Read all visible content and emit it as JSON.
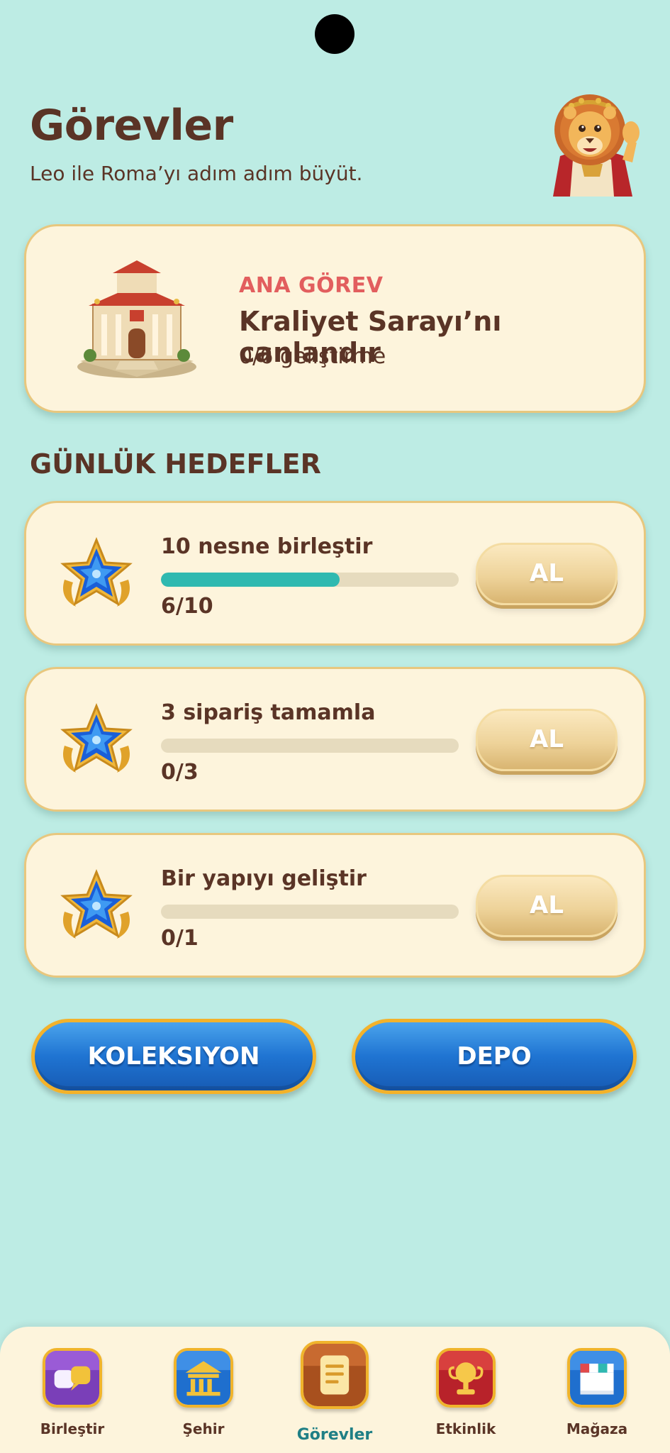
{
  "header": {
    "title": "Görevler",
    "subtitle": "Leo ile Roma’yı adım adım büyüt."
  },
  "main_quest": {
    "tag": "ANA GÖREV",
    "name": "Kraliyet Sarayı’nı canlandır",
    "progress": "0/6 geliştirme"
  },
  "daily": {
    "title": "GÜNLÜK HEDEFLER",
    "goals": [
      {
        "label": "10 nesne birleştir",
        "count": "6/10",
        "progress": 0.6,
        "button": "AL",
        "icon": "star-badge-icon"
      },
      {
        "label": "3 sipariş tamamla",
        "count": "0/3",
        "progress": 0,
        "button": "AL",
        "icon": "star-badge-icon"
      },
      {
        "label": "Bir yapıyı geliştir",
        "count": "0/1",
        "progress": 0,
        "button": "AL",
        "icon": "star-badge-icon"
      }
    ]
  },
  "actions": {
    "collection": "KOLEKSIYON",
    "depot": "DEPO"
  },
  "nav": {
    "items": [
      {
        "label": "Birleştir",
        "icon": "merge-icon",
        "active": false
      },
      {
        "label": "Şehir",
        "icon": "city-hall-icon",
        "active": false
      },
      {
        "label": "Görevler",
        "icon": "quest-scroll-icon",
        "active": true
      },
      {
        "label": "Etkinlik",
        "icon": "trophy-icon",
        "active": false
      },
      {
        "label": "Mağaza",
        "icon": "shop-icon",
        "active": false
      }
    ]
  },
  "colors": {
    "background": "#bdece4",
    "card": "#fdf4dc",
    "accent_red": "#e25e5e",
    "progress_fill": "#2fb9b0",
    "button_blue": "#1f74d2",
    "button_border": "#f3b22a",
    "text_brown": "#5a3426",
    "active_nav": "#1f7f85"
  }
}
